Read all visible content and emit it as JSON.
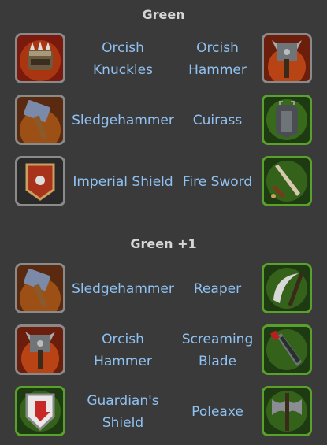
{
  "sections": [
    {
      "title": "Green",
      "rows": [
        {
          "left": {
            "name": "Orcish\nKnuckles",
            "icon": "orcish-knuckles-icon"
          },
          "right": {
            "name": "Orcish\nHammer",
            "icon": "orcish-hammer-icon"
          }
        },
        {
          "left": {
            "name": "Sledgehammer",
            "icon": "sledgehammer-icon"
          },
          "right": {
            "name": "Cuirass",
            "icon": "cuirass-icon"
          }
        },
        {
          "left": {
            "name": "Imperial Shield",
            "icon": "imperial-shield-icon"
          },
          "right": {
            "name": "Fire Sword",
            "icon": "fire-sword-icon"
          }
        }
      ]
    },
    {
      "title": "Green +1",
      "rows": [
        {
          "left": {
            "name": "Sledgehammer",
            "icon": "sledgehammer-icon"
          },
          "right": {
            "name": "Reaper",
            "icon": "reaper-icon"
          }
        },
        {
          "left": {
            "name": "Orcish\nHammer",
            "icon": "orcish-hammer-icon"
          },
          "right": {
            "name": "Screaming\nBlade",
            "icon": "screaming-blade-icon"
          }
        },
        {
          "left": {
            "name": "Guardian's\nShield",
            "icon": "guardians-shield-icon"
          },
          "right": {
            "name": "Poleaxe",
            "icon": "poleaxe-icon"
          }
        }
      ]
    }
  ],
  "colors": {
    "background": "#3a3a3a",
    "item_text": "#8fc1f2",
    "frame_grey": "#8a8a8a",
    "frame_green": "#5aa02c"
  }
}
